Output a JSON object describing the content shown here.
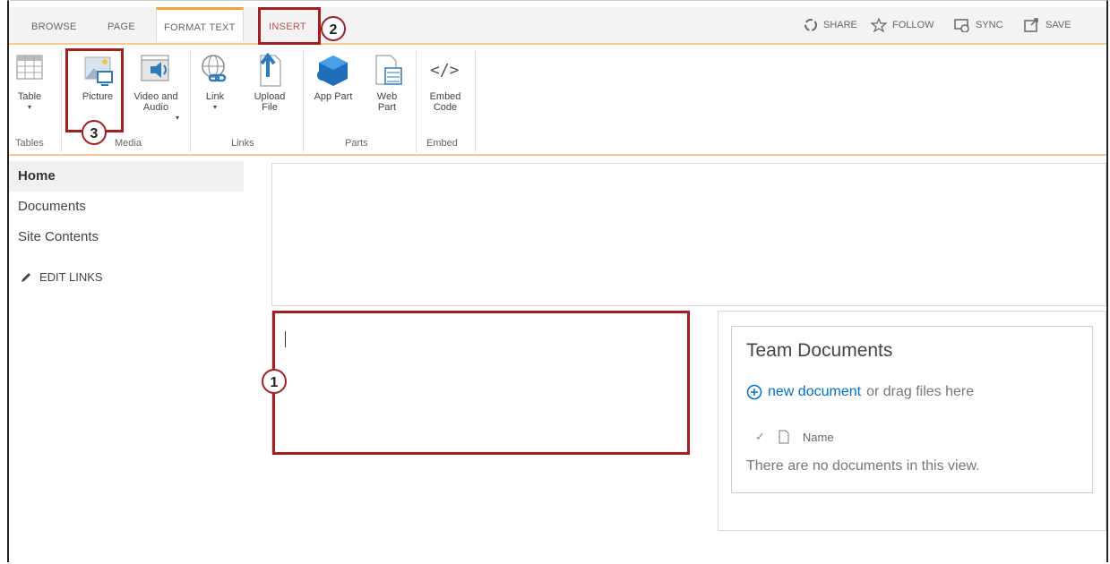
{
  "tabs": [
    {
      "label": "BROWSE"
    },
    {
      "label": "PAGE"
    },
    {
      "label": "FORMAT TEXT"
    },
    {
      "label": "INSERT"
    }
  ],
  "top_actions": [
    {
      "label": "SHARE",
      "icon": "share-icon"
    },
    {
      "label": "FOLLOW",
      "icon": "star-icon"
    },
    {
      "label": "SYNC",
      "icon": "sync-icon"
    },
    {
      "label": "SAVE",
      "icon": "save-icon"
    }
  ],
  "ribbon": {
    "buttons": {
      "table": "Table",
      "picture": "Picture",
      "video_audio": "Video and Audio",
      "link": "Link",
      "upload_file": "Upload File",
      "app_part": "App Part",
      "web_part": "Web Part",
      "embed_code": "Embed Code"
    },
    "groups": {
      "tables": "Tables",
      "media": "Media",
      "links": "Links",
      "parts": "Parts",
      "embed": "Embed"
    }
  },
  "annotations": [
    "1",
    "2",
    "3"
  ],
  "nav": {
    "items": [
      "Home",
      "Documents",
      "Site Contents"
    ],
    "edit_links": "EDIT LINKS"
  },
  "team_documents": {
    "title": "Team Documents",
    "new_document": "new document",
    "drag_text": "or drag files here",
    "column_name": "Name",
    "empty": "There are no documents in this view."
  },
  "colors": {
    "accent_orange": "#f2a33a",
    "annotation_red": "#a41f22",
    "link_blue": "#0072c6"
  }
}
